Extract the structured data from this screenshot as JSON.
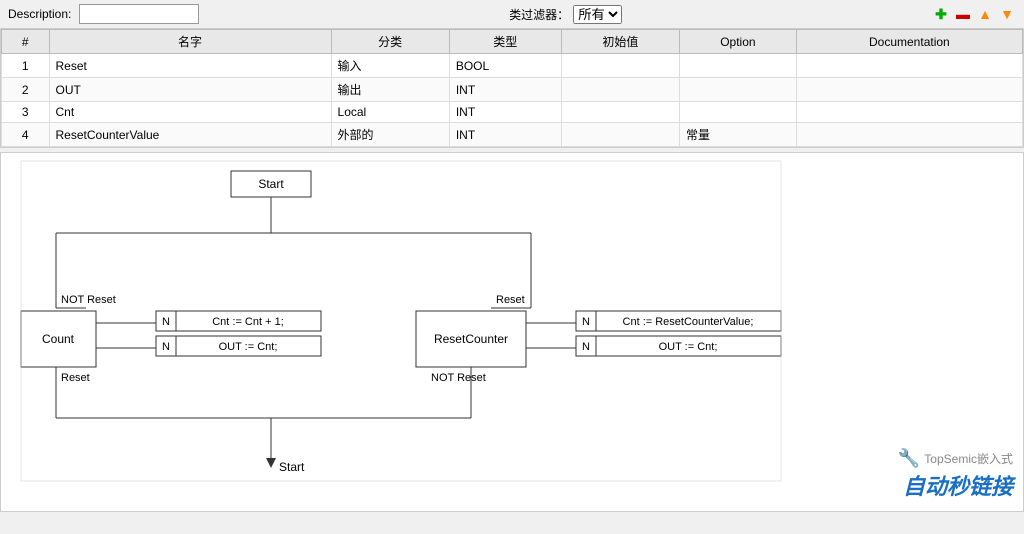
{
  "topbar": {
    "description_label": "Description:",
    "description_value": "",
    "filter_label": "类过滤器：",
    "filter_option": "所有"
  },
  "table": {
    "columns": [
      "#",
      "名字",
      "分类",
      "类型",
      "初始值",
      "Option",
      "Documentation"
    ],
    "rows": [
      {
        "id": "1",
        "name": "Reset",
        "category": "输入",
        "type": "BOOL",
        "init": "",
        "option": "",
        "doc": ""
      },
      {
        "id": "2",
        "name": "OUT",
        "category": "输出",
        "type": "INT",
        "init": "",
        "option": "",
        "doc": ""
      },
      {
        "id": "3",
        "name": "Cnt",
        "category": "Local",
        "type": "INT",
        "init": "",
        "option": "",
        "doc": ""
      },
      {
        "id": "4",
        "name": "ResetCounterValue",
        "category": "外部的",
        "type": "INT",
        "init": "",
        "option": "常量",
        "doc": ""
      }
    ]
  },
  "diagram": {
    "start_label": "Start",
    "count_label": "Count",
    "resetcounter_label": "ResetCounter",
    "not_reset_label1": "NOT Reset",
    "reset_label1": "Reset",
    "reset_label2": "Reset",
    "not_reset_label2": "NOT Reset",
    "n1": "N",
    "n2": "N",
    "n3": "N",
    "n4": "N",
    "cnt_action1": "Cnt := Cnt + 1;",
    "cnt_action2": "OUT := Cnt;",
    "cnt_action3": "Cnt := ResetCounterValue;",
    "cnt_action4": "OUT := Cnt;",
    "start_bottom": "Start"
  },
  "watermark": {
    "brand": "TopSemic嵌入式",
    "slogan": "自动秒链接"
  }
}
